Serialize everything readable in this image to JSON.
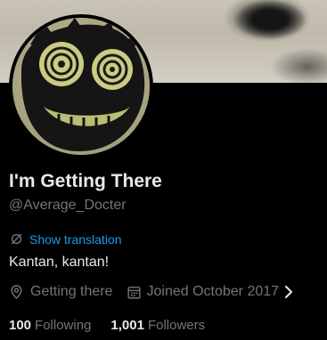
{
  "profile": {
    "display_name": "I'm Getting There",
    "handle": "@Average_Docter",
    "translation_link": "Show translation",
    "bio": "Kantan, kantan!",
    "location": "Getting there",
    "joined": "Joined October 2017"
  },
  "stats": {
    "following_count": "100",
    "following_label": "Following",
    "followers_count": "1,001",
    "followers_label": "Followers"
  },
  "colors": {
    "background": "#000000",
    "primary_text": "#e7e9ea",
    "secondary_text": "#71767b",
    "link": "#1d9bf0"
  },
  "icons": {
    "translation": "translate-icon",
    "location": "location-pin-icon",
    "joined": "calendar-icon",
    "more": "chevron-right-icon"
  }
}
